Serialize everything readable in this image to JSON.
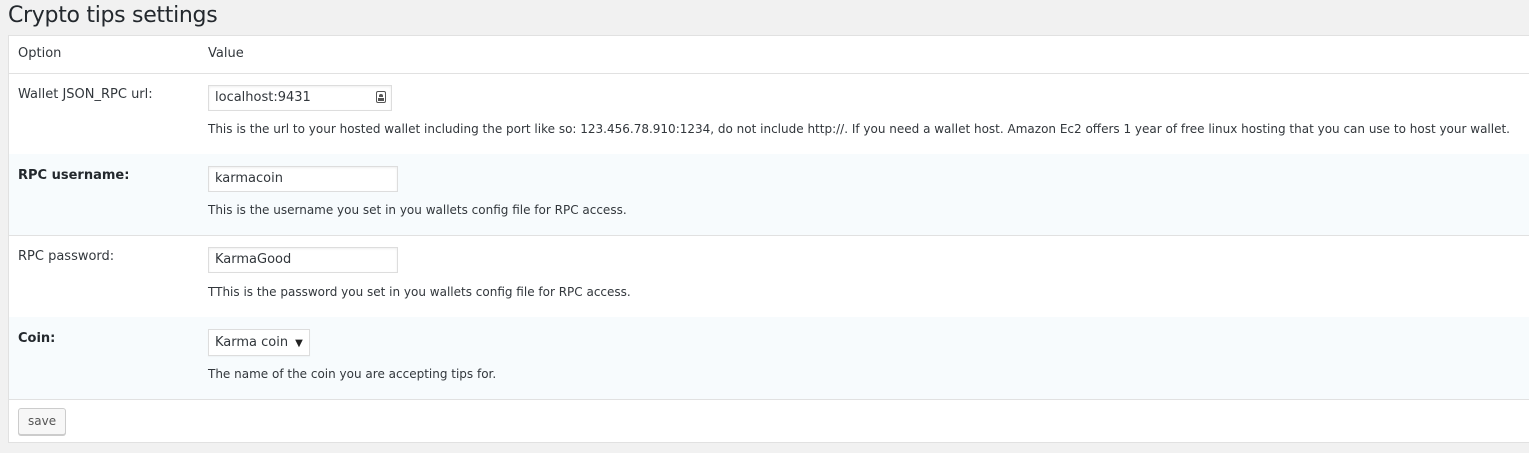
{
  "page": {
    "title": "Crypto tips settings"
  },
  "table": {
    "header": {
      "option": "Option",
      "value": "Value"
    },
    "rows": [
      {
        "label": "Wallet JSON_RPC url:",
        "value": "localhost:9431",
        "description": "This is the url to your hosted wallet including the port like so: 123.456.78.910:1234, do not include http://. If you need a wallet host. Amazon Ec2 offers 1 year of free linux hosting that you can use to host your wallet."
      },
      {
        "label": "RPC username:",
        "value": "karmacoin",
        "description": "This is the username you set in you wallets config file for RPC access."
      },
      {
        "label": "RPC password:",
        "value": "KarmaGood",
        "description": "TThis is the password you set in you wallets config file for RPC access."
      },
      {
        "label": "Coin:",
        "value": "Karma coin",
        "caret": "▼",
        "description": "The name of the coin you are accepting tips for."
      }
    ]
  },
  "actions": {
    "save_label": "save"
  },
  "icons": {
    "url_field": "contact-card-icon",
    "select_caret": "caret-down-icon"
  },
  "colors": {
    "alt_row_bg": "#f7fbfd",
    "border": "#e1e1e1",
    "page_bg": "#f1f1f1"
  }
}
